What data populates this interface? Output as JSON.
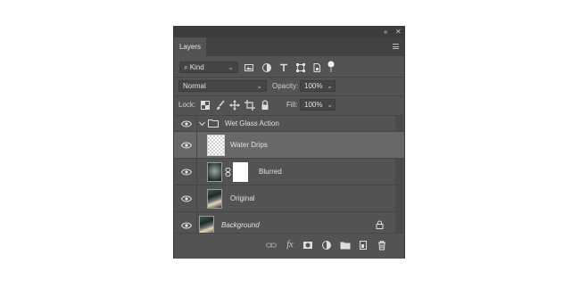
{
  "panel": {
    "collapse_glyph": "«",
    "close_glyph": "✕",
    "tab_label": "Layers",
    "filter": {
      "kind_label": "Kind"
    },
    "blend": {
      "mode": "Normal",
      "opacity_label": "Opacity:",
      "opacity_value": "100%"
    },
    "lock": {
      "label": "Lock:",
      "fill_label": "Fill:",
      "fill_value": "100%"
    },
    "layers": [
      {
        "name": "Wet Glass Action",
        "type": "group"
      },
      {
        "name": "Water Drips",
        "type": "transparent",
        "selected": true
      },
      {
        "name": "Blurred",
        "type": "masked"
      },
      {
        "name": "Original",
        "type": "photo"
      },
      {
        "name": "Background",
        "type": "background",
        "locked": true
      }
    ],
    "bottom_icons": [
      "link-layers-icon",
      "fx-icon",
      "add-mask-icon",
      "adjustment-layer-icon",
      "new-group-icon",
      "new-layer-icon",
      "trash-icon"
    ],
    "fx_label": "fx"
  },
  "colors": {
    "panel_bg": "#535353",
    "selected_row": "#686868",
    "title_bg": "#3c3c3c"
  }
}
